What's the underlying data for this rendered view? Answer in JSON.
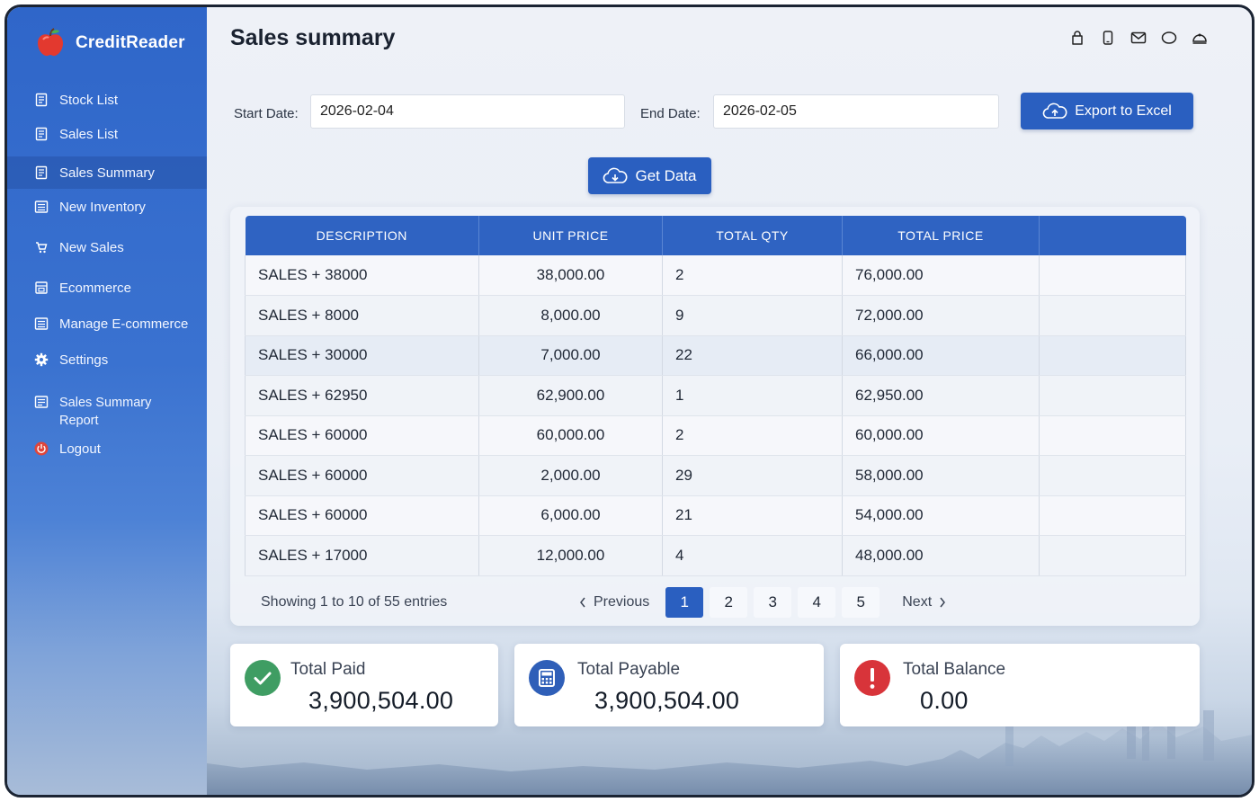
{
  "app": {
    "brand_name": "CreditReader",
    "brand_icon": "apple-icon",
    "accent_color": "#2a5fc0"
  },
  "sidebar": {
    "items": [
      {
        "label": "Stock List",
        "icon": "document-icon"
      },
      {
        "label": "Sales List",
        "icon": "document-icon"
      },
      {
        "label": "Sales Summary",
        "icon": "document-icon",
        "active": true
      },
      {
        "label": "New Inventory",
        "icon": "list-icon"
      },
      {
        "label": "New Sales",
        "icon": "cart-icon"
      },
      {
        "label": "Ecommerce",
        "icon": "store-icon"
      },
      {
        "label": "Manage E-commerce",
        "icon": "list-icon"
      },
      {
        "label": "Settings",
        "icon": "gear-icon"
      },
      {
        "label": "Sales Summary Report",
        "icon": "report-icon"
      },
      {
        "label": "Logout",
        "icon": "power-icon"
      }
    ]
  },
  "header": {
    "title": "Sales summary",
    "icons": [
      "bag-icon",
      "phone-icon",
      "mail-icon",
      "chat-icon",
      "profile-icon"
    ]
  },
  "filters": {
    "start_label": "Start Date:",
    "start_value": "2026-02-04",
    "end_label": "End Date:",
    "end_value": "2026-02-05",
    "export_label": "Export to Excel",
    "get_data_label": "Get Data"
  },
  "table": {
    "columns": [
      "DESCRIPTION",
      "UNIT PRICE",
      "TOTAL QTY",
      "TOTAL PRICE",
      ""
    ],
    "rows": [
      [
        "SALES + 38000",
        "38,000.00",
        "2",
        "76,000.00",
        ""
      ],
      [
        "SALES + 8000",
        "8,000.00",
        "9",
        "72,000.00",
        ""
      ],
      [
        "SALES + 30000",
        "7,000.00",
        "22",
        "66,000.00",
        ""
      ],
      [
        "SALES + 62950",
        "62,900.00",
        "1",
        "62,950.00",
        ""
      ],
      [
        "SALES + 60000",
        "60,000.00",
        "2",
        "60,000.00",
        ""
      ],
      [
        "SALES + 60000",
        "2,000.00",
        "29",
        "58,000.00",
        ""
      ],
      [
        "SALES + 60000",
        "6,000.00",
        "21",
        "54,000.00",
        ""
      ],
      [
        "SALES + 17000",
        "12,000.00",
        "4",
        "48,000.00",
        ""
      ]
    ]
  },
  "pagination": {
    "entries_text": "Showing 1 to 10 of 55 entries",
    "previous_label": "Previous",
    "next_label": "Next",
    "pages": [
      "1",
      "2",
      "3",
      "4",
      "5"
    ],
    "current_page": "1"
  },
  "summary": {
    "paid": {
      "title": "Total Paid",
      "value": "3,900,504.00",
      "icon": "check-circle-icon",
      "color": "#3f9d63"
    },
    "payable": {
      "title": "Total Payable",
      "value": "3,900,504.00",
      "icon": "calculator-icon",
      "color": "#2f5fb8"
    },
    "balance": {
      "title": "Total Balance",
      "value": "0.00",
      "icon": "alert-icon",
      "color": "#d8343a"
    }
  }
}
